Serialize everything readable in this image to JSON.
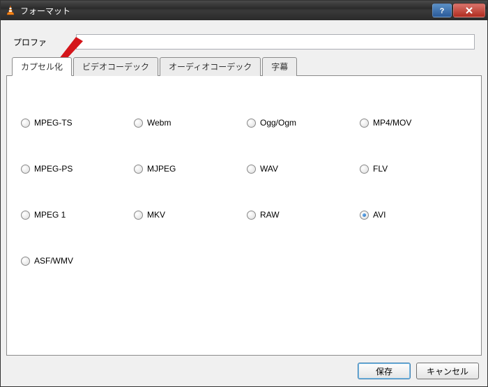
{
  "window": {
    "title": "フォーマット"
  },
  "profile": {
    "label": "プロファ",
    "value": ""
  },
  "tabs": [
    {
      "label": "カプセル化",
      "active": true
    },
    {
      "label": "ビデオコーデック",
      "active": false
    },
    {
      "label": "オーディオコーデック",
      "active": false
    },
    {
      "label": "字幕",
      "active": false
    }
  ],
  "formats": [
    {
      "label": "MPEG-TS",
      "selected": false
    },
    {
      "label": "Webm",
      "selected": false
    },
    {
      "label": "Ogg/Ogm",
      "selected": false
    },
    {
      "label": "MP4/MOV",
      "selected": false
    },
    {
      "label": "MPEG-PS",
      "selected": false
    },
    {
      "label": "MJPEG",
      "selected": false
    },
    {
      "label": "WAV",
      "selected": false
    },
    {
      "label": "FLV",
      "selected": false
    },
    {
      "label": "MPEG 1",
      "selected": false
    },
    {
      "label": "MKV",
      "selected": false
    },
    {
      "label": "RAW",
      "selected": false
    },
    {
      "label": "AVI",
      "selected": true
    },
    {
      "label": "ASF/WMV",
      "selected": false
    }
  ],
  "buttons": {
    "save": "保存",
    "cancel": "キャンセル"
  },
  "colors": {
    "accent": "#2a6fb5",
    "arrow": "#d4151a"
  }
}
